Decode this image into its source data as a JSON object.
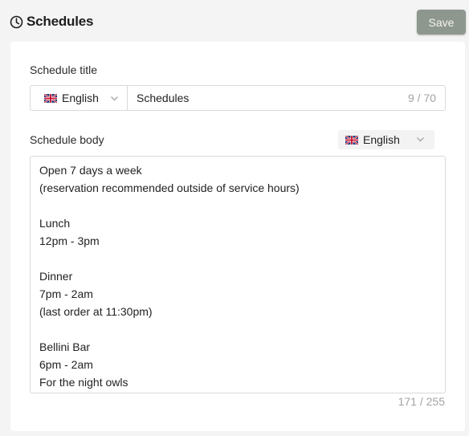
{
  "header": {
    "title": "Schedules",
    "save_label": "Save"
  },
  "form": {
    "title_label": "Schedule title",
    "title_language": "English",
    "title_value": "Schedules",
    "title_counter": "9 / 70",
    "body_label": "Schedule body",
    "body_language": "English",
    "body_lines": [
      "Open 7 days a week",
      "(reservation recommended outside of service hours)",
      "",
      "Lunch",
      "12pm - 3pm",
      "",
      "Dinner",
      "7pm - 2am",
      "(last order at 11:30pm)",
      "",
      "Bellini Bar",
      "6pm - 2am",
      "For the night owls"
    ],
    "body_counter": "171 / 255"
  },
  "icons": {
    "title_icon": "clock-icon",
    "language_flag": "uk-flag-icon",
    "dropdown": "chevron-down-icon"
  },
  "colors": {
    "save_button": "#8e978e",
    "background": "#f4f4f4",
    "card": "#ffffff"
  }
}
